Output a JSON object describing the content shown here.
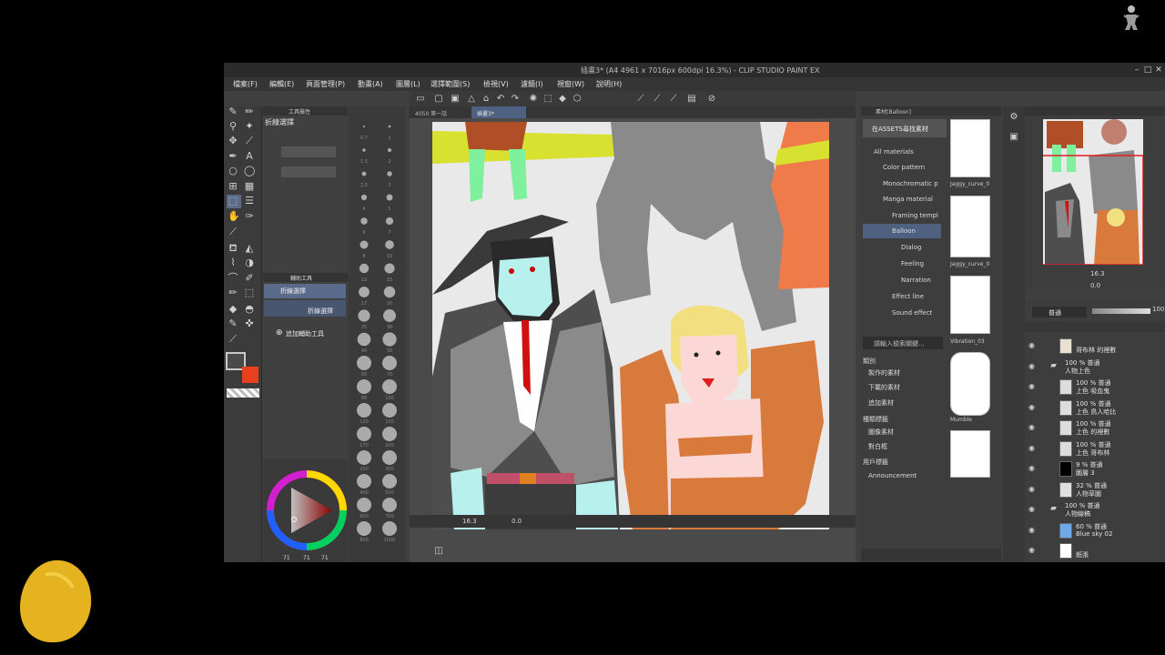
{
  "window": {
    "title": "插畫3* (A4 4961 x 7016px 600dpi 16.3%) - CLIP STUDIO PAINT EX",
    "controls": [
      "–",
      "□",
      "✕"
    ]
  },
  "menu": [
    "檔案(F)",
    "編輯(E)",
    "頁面管理(P)",
    "動畫(A)",
    "圖層(L)",
    "選擇範圍(S)",
    "檢視(V)",
    "濾鏡(I)",
    "視窗(W)",
    "說明(H)"
  ],
  "canvas_tabs": [
    "4050 第一話",
    "插畫3*"
  ],
  "tool_property": {
    "header": "工具屬性",
    "title": "折線選擇"
  },
  "sub_tool": {
    "header": "輔助工具",
    "items": [
      "折線選擇",
      "折線選擇"
    ],
    "add_label": "追加輔助工具"
  },
  "brush_sizes": [
    "0.7",
    "1",
    "1.5",
    "2",
    "2.5",
    "3",
    "4",
    "5",
    "6",
    "7",
    "8",
    "10",
    "12",
    "15",
    "17",
    "20",
    "25",
    "30",
    "40",
    "50",
    "60",
    "70",
    "80",
    "100",
    "120",
    "150",
    "170",
    "200",
    "250",
    "300",
    "400",
    "500",
    "600",
    "700",
    "800",
    "1000"
  ],
  "color": {
    "main": "#4a4a4a",
    "sub": "#e8401c",
    "values": [
      "71",
      "71",
      "71"
    ]
  },
  "status": {
    "zoom": "16.3",
    "angle": "0.0"
  },
  "material": {
    "header": "素材[Balloon]",
    "assets_btn": "在ASSETS尋找素材",
    "tree": [
      "All materials",
      "Color pattern",
      "Monochromatic p",
      "Manga material",
      "Framing templ",
      "Balloon",
      "Dialog",
      "Feeling",
      "Narration",
      "Effect line",
      "Sound effect"
    ],
    "thumbs": [
      "Jaggy_curve_0",
      "Jaggy_curve_0",
      "Vibration_03",
      "Mumble",
      ""
    ],
    "search_placeholder": "請輸入檢索關鍵...",
    "filter_hdr1": "類別",
    "filter_items1": [
      "製作的素材",
      "下載的素材",
      "追加素材"
    ],
    "filter_hdr2": "種類標籤",
    "filter_items2": [
      "圖像素材",
      "對白框"
    ],
    "filter_hdr3": "用戶標籤",
    "filter_items3": [
      "Announcement"
    ]
  },
  "navigator": {
    "zoom": "16.3",
    "angle": "0.0"
  },
  "layer_panel": {
    "blend": "普通",
    "opacity": "100",
    "layers": [
      {
        "pct": "",
        "name": "哥布林 的裡數",
        "folder": false,
        "thumb": "#e8e0d0"
      },
      {
        "pct": "100 % 普通",
        "name": "人物上色",
        "folder": true,
        "thumb": ""
      },
      {
        "pct": "100 % 普通",
        "name": "上色 吸血鬼",
        "folder": false,
        "thumb": "#ddd"
      },
      {
        "pct": "100 % 普通",
        "name": "上色 鳥人哈比",
        "folder": false,
        "thumb": "#ddd"
      },
      {
        "pct": "100 % 普通",
        "name": "上色 的裡數",
        "folder": false,
        "thumb": "#ddd"
      },
      {
        "pct": "100 % 普通",
        "name": "上色 哥布林",
        "folder": false,
        "thumb": "#ddd"
      },
      {
        "pct": "9 % 普通",
        "name": "圖層 3",
        "folder": false,
        "thumb": "#000"
      },
      {
        "pct": "32 % 普通",
        "name": "人物草圖",
        "folder": false,
        "thumb": "#e0e0e0"
      },
      {
        "pct": "100 % 普通",
        "name": "人物線稿",
        "folder": true,
        "thumb": ""
      },
      {
        "pct": "60 % 普通",
        "name": "Blue sky 02",
        "folder": false,
        "thumb": "#6da8e8"
      },
      {
        "pct": "",
        "name": "紙張",
        "folder": false,
        "thumb": "#ffffff"
      }
    ]
  }
}
